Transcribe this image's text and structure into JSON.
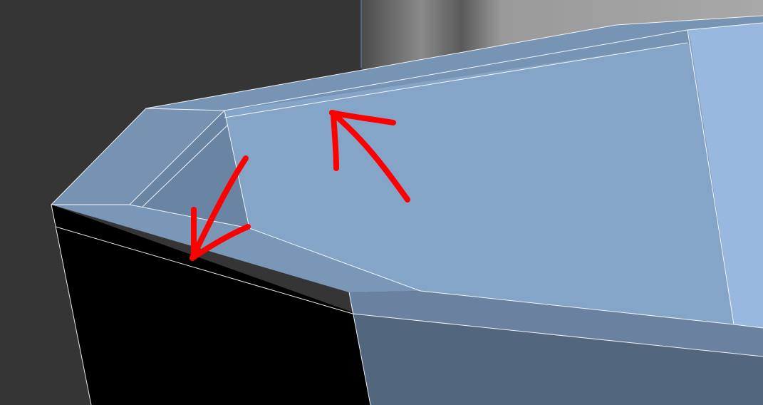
{
  "scene": {
    "description_visible_text": "",
    "viewport_background_color": "#3a3a3a",
    "backdrop_gray_color": "#8c8c8c",
    "mesh_top_light_color": "#9fb8d6",
    "mesh_top_mid_color": "#84a5c9",
    "mesh_side_dark_color": "#55697f",
    "mesh_black_face_color": "#000000",
    "edge_line_color": "#ffffff",
    "annotation_color": "#ff0000"
  },
  "annotations": {
    "arrow_1_icon": "arrow-up-left-icon",
    "arrow_2_icon": "arrow-down-left-icon"
  }
}
